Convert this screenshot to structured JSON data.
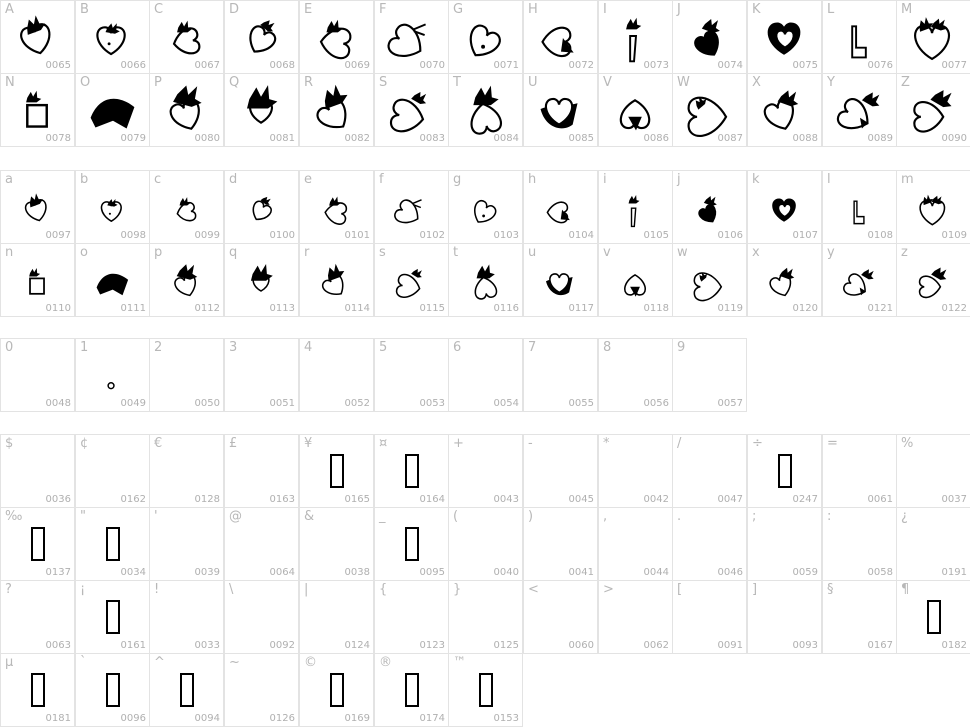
{
  "sections": [
    {
      "id": "upper",
      "rows": [
        [
          {
            "char": "A",
            "code": "0065",
            "glyph": "char-A"
          },
          {
            "char": "B",
            "code": "0066",
            "glyph": "char-B"
          },
          {
            "char": "C",
            "code": "0067",
            "glyph": "char-C"
          },
          {
            "char": "D",
            "code": "0068",
            "glyph": "char-D"
          },
          {
            "char": "E",
            "code": "0069",
            "glyph": "char-E"
          },
          {
            "char": "F",
            "code": "0070",
            "glyph": "char-F"
          },
          {
            "char": "G",
            "code": "0071",
            "glyph": "char-G"
          },
          {
            "char": "H",
            "code": "0072",
            "glyph": "char-H"
          },
          {
            "char": "I",
            "code": "0073",
            "glyph": "char-I"
          },
          {
            "char": "J",
            "code": "0074",
            "glyph": "char-J"
          },
          {
            "char": "K",
            "code": "0075",
            "glyph": "char-K"
          },
          {
            "char": "L",
            "code": "0076",
            "glyph": "char-L"
          },
          {
            "char": "M",
            "code": "0077",
            "glyph": "char-M"
          }
        ],
        [
          {
            "char": "N",
            "code": "0078",
            "glyph": "char-N"
          },
          {
            "char": "O",
            "code": "0079",
            "glyph": "char-O"
          },
          {
            "char": "P",
            "code": "0080",
            "glyph": "char-P"
          },
          {
            "char": "Q",
            "code": "0081",
            "glyph": "char-Q"
          },
          {
            "char": "R",
            "code": "0082",
            "glyph": "char-R"
          },
          {
            "char": "S",
            "code": "0083",
            "glyph": "char-S"
          },
          {
            "char": "T",
            "code": "0084",
            "glyph": "char-T"
          },
          {
            "char": "U",
            "code": "0085",
            "glyph": "char-U"
          },
          {
            "char": "V",
            "code": "0086",
            "glyph": "char-V"
          },
          {
            "char": "W",
            "code": "0087",
            "glyph": "char-W"
          },
          {
            "char": "X",
            "code": "0088",
            "glyph": "char-X"
          },
          {
            "char": "Y",
            "code": "0089",
            "glyph": "char-Y"
          },
          {
            "char": "Z",
            "code": "0090",
            "glyph": "char-Z"
          }
        ]
      ]
    },
    {
      "id": "lower",
      "rows": [
        [
          {
            "char": "a",
            "code": "0097",
            "glyph": "char-a"
          },
          {
            "char": "b",
            "code": "0098",
            "glyph": "char-b"
          },
          {
            "char": "c",
            "code": "0099",
            "glyph": "char-c"
          },
          {
            "char": "d",
            "code": "0100",
            "glyph": "char-d"
          },
          {
            "char": "e",
            "code": "0101",
            "glyph": "char-e"
          },
          {
            "char": "f",
            "code": "0102",
            "glyph": "char-f"
          },
          {
            "char": "g",
            "code": "0103",
            "glyph": "char-g"
          },
          {
            "char": "h",
            "code": "0104",
            "glyph": "char-h"
          },
          {
            "char": "i",
            "code": "0105",
            "glyph": "char-i"
          },
          {
            "char": "j",
            "code": "0106",
            "glyph": "char-j"
          },
          {
            "char": "k",
            "code": "0107",
            "glyph": "char-k"
          },
          {
            "char": "l",
            "code": "0108",
            "glyph": "char-l"
          },
          {
            "char": "m",
            "code": "0109",
            "glyph": "char-m"
          }
        ],
        [
          {
            "char": "n",
            "code": "0110",
            "glyph": "char-n"
          },
          {
            "char": "o",
            "code": "0111",
            "glyph": "char-o"
          },
          {
            "char": "p",
            "code": "0112",
            "glyph": "char-p"
          },
          {
            "char": "q",
            "code": "0113",
            "glyph": "char-q"
          },
          {
            "char": "r",
            "code": "0114",
            "glyph": "char-r"
          },
          {
            "char": "s",
            "code": "0115",
            "glyph": "char-s"
          },
          {
            "char": "t",
            "code": "0116",
            "glyph": "char-t"
          },
          {
            "char": "u",
            "code": "0117",
            "glyph": "char-u"
          },
          {
            "char": "v",
            "code": "0118",
            "glyph": "char-v"
          },
          {
            "char": "w",
            "code": "0119",
            "glyph": "char-w"
          },
          {
            "char": "x",
            "code": "0120",
            "glyph": "char-x"
          },
          {
            "char": "y",
            "code": "0121",
            "glyph": "char-y"
          },
          {
            "char": "z",
            "code": "0122",
            "glyph": "char-z"
          }
        ]
      ]
    },
    {
      "id": "digits",
      "rows": [
        [
          {
            "char": "0",
            "code": "0048",
            "glyph": "empty"
          },
          {
            "char": "1",
            "code": "0049",
            "glyph": "small-circle"
          },
          {
            "char": "2",
            "code": "0050",
            "glyph": "empty"
          },
          {
            "char": "3",
            "code": "0051",
            "glyph": "empty"
          },
          {
            "char": "4",
            "code": "0052",
            "glyph": "empty"
          },
          {
            "char": "5",
            "code": "0053",
            "glyph": "empty"
          },
          {
            "char": "6",
            "code": "0054",
            "glyph": "empty"
          },
          {
            "char": "7",
            "code": "0055",
            "glyph": "empty"
          },
          {
            "char": "8",
            "code": "0056",
            "glyph": "empty"
          },
          {
            "char": "9",
            "code": "0057",
            "glyph": "empty"
          }
        ]
      ]
    },
    {
      "id": "symbols",
      "rows": [
        [
          {
            "char": "$",
            "code": "0036",
            "glyph": "empty"
          },
          {
            "char": "¢",
            "code": "0162",
            "glyph": "empty"
          },
          {
            "char": "€",
            "code": "0128",
            "glyph": "empty"
          },
          {
            "char": "£",
            "code": "0163",
            "glyph": "empty"
          },
          {
            "char": "¥",
            "code": "0165",
            "glyph": "notdef"
          },
          {
            "char": "¤",
            "code": "0164",
            "glyph": "notdef"
          },
          {
            "char": "+",
            "code": "0043",
            "glyph": "empty"
          },
          {
            "char": "-",
            "code": "0045",
            "glyph": "empty"
          },
          {
            "char": "*",
            "code": "0042",
            "glyph": "empty"
          },
          {
            "char": "/",
            "code": "0047",
            "glyph": "empty"
          },
          {
            "char": "÷",
            "code": "0247",
            "glyph": "notdef"
          },
          {
            "char": "=",
            "code": "0061",
            "glyph": "empty"
          },
          {
            "char": "%",
            "code": "0037",
            "glyph": "empty"
          }
        ],
        [
          {
            "char": "‰",
            "code": "0137",
            "glyph": "notdef"
          },
          {
            "char": "\"",
            "code": "0034",
            "glyph": "notdef"
          },
          {
            "char": "'",
            "code": "0039",
            "glyph": "empty"
          },
          {
            "char": "@",
            "code": "0064",
            "glyph": "empty"
          },
          {
            "char": "&",
            "code": "0038",
            "glyph": "empty"
          },
          {
            "char": "_",
            "code": "0095",
            "glyph": "notdef"
          },
          {
            "char": "(",
            "code": "0040",
            "glyph": "empty"
          },
          {
            "char": ")",
            "code": "0041",
            "glyph": "empty"
          },
          {
            "char": ",",
            "code": "0044",
            "glyph": "empty"
          },
          {
            "char": ".",
            "code": "0046",
            "glyph": "empty"
          },
          {
            "char": ";",
            "code": "0059",
            "glyph": "empty"
          },
          {
            "char": ":",
            "code": "0058",
            "glyph": "empty"
          },
          {
            "char": "¿",
            "code": "0191",
            "glyph": "empty"
          }
        ],
        [
          {
            "char": "?",
            "code": "0063",
            "glyph": "empty"
          },
          {
            "char": "¡",
            "code": "0161",
            "glyph": "notdef"
          },
          {
            "char": "!",
            "code": "0033",
            "glyph": "empty"
          },
          {
            "char": "\\",
            "code": "0092",
            "glyph": "empty"
          },
          {
            "char": "|",
            "code": "0124",
            "glyph": "empty"
          },
          {
            "char": "{",
            "code": "0123",
            "glyph": "empty"
          },
          {
            "char": "}",
            "code": "0125",
            "glyph": "empty"
          },
          {
            "char": "<",
            "code": "0060",
            "glyph": "empty"
          },
          {
            "char": ">",
            "code": "0062",
            "glyph": "empty"
          },
          {
            "char": "[",
            "code": "0091",
            "glyph": "empty"
          },
          {
            "char": "]",
            "code": "0093",
            "glyph": "empty"
          },
          {
            "char": "§",
            "code": "0167",
            "glyph": "empty"
          },
          {
            "char": "¶",
            "code": "0182",
            "glyph": "notdef"
          }
        ],
        [
          {
            "char": "µ",
            "code": "0181",
            "glyph": "notdef"
          },
          {
            "char": "`",
            "code": "0096",
            "glyph": "notdef"
          },
          {
            "char": "^",
            "code": "0094",
            "glyph": "notdef"
          },
          {
            "char": "~",
            "code": "0126",
            "glyph": "empty"
          },
          {
            "char": "©",
            "code": "0169",
            "glyph": "notdef"
          },
          {
            "char": "®",
            "code": "0174",
            "glyph": "notdef"
          },
          {
            "char": "™",
            "code": "0153",
            "glyph": "notdef"
          }
        ]
      ]
    }
  ]
}
